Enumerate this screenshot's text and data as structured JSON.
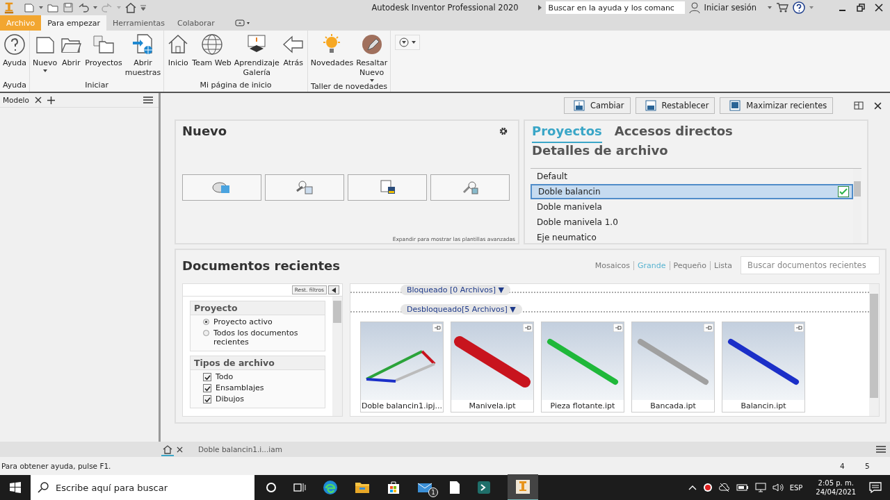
{
  "window": {
    "title": "Autodesk Inventor Professional 2020"
  },
  "help_search": {
    "placeholder": "Buscar en la ayuda y los comanc"
  },
  "sign_in": "Iniciar sesión",
  "ribbon_tabs": [
    {
      "label": "Archivo",
      "kind": "application",
      "selected": false
    },
    {
      "label": "Para empezar",
      "kind": "tab",
      "selected": true
    },
    {
      "label": "Herramientas",
      "kind": "tab",
      "selected": false
    },
    {
      "label": "Colaborar",
      "kind": "tab",
      "selected": false
    }
  ],
  "ribbon_groups": [
    {
      "label": "Ayuda",
      "buttons": [
        {
          "lines": [
            "Ayuda"
          ],
          "dropdown": false
        }
      ]
    },
    {
      "label": "Iniciar",
      "buttons": [
        {
          "lines": [
            "Nuevo"
          ],
          "dropdown": true
        },
        {
          "lines": [
            "Abrir"
          ],
          "dropdown": false
        },
        {
          "lines": [
            "Proyectos"
          ],
          "dropdown": false
        },
        {
          "lines": [
            "Abrir",
            "muestras"
          ],
          "dropdown": false
        }
      ]
    },
    {
      "label": "Mi página de inicio",
      "buttons": [
        {
          "lines": [
            "Inicio"
          ],
          "dropdown": false
        },
        {
          "lines": [
            "Team Web"
          ],
          "dropdown": false
        },
        {
          "lines": [
            "Aprendizaje",
            "Galería"
          ],
          "dropdown": false
        },
        {
          "lines": [
            "Atrás"
          ],
          "dropdown": false
        }
      ]
    },
    {
      "label": "Taller de novedades",
      "buttons": [
        {
          "lines": [
            "Novedades"
          ],
          "dropdown": false
        },
        {
          "lines": [
            "Resaltar",
            "Nuevo"
          ],
          "dropdown": true
        }
      ]
    }
  ],
  "browser": {
    "tab": "Modelo"
  },
  "toolbar": [
    "Cambiar",
    "Restablecer",
    "Maximizar recientes"
  ],
  "new_panel": {
    "title": "Nuevo",
    "hint": "Expandir para mostrar las plantillas avanzadas"
  },
  "project_tabs": [
    {
      "label": "Proyectos",
      "selected": true
    },
    {
      "label": "Accesos directos",
      "selected": false
    },
    {
      "label": "Detalles de archivo",
      "selected": false
    }
  ],
  "projects": [
    {
      "name": "Default",
      "selected": false,
      "active": false
    },
    {
      "name": "Doble balancin",
      "selected": true,
      "active": true
    },
    {
      "name": "Doble manivela",
      "selected": false,
      "active": false
    },
    {
      "name": "Doble manivela 1.0",
      "selected": false,
      "active": false
    },
    {
      "name": "Eje neumatico",
      "selected": false,
      "active": false
    }
  ],
  "recent": {
    "title": "Documentos recientes",
    "views": [
      {
        "label": "Mosaicos",
        "selected": false
      },
      {
        "label": "Grande",
        "selected": true
      },
      {
        "label": "Pequeño",
        "selected": false
      },
      {
        "label": "Lista",
        "selected": false
      }
    ],
    "search": {
      "placeholder": "Buscar documentos recientes"
    },
    "reset_filters": "Rest. filtros",
    "project_filter": {
      "title": "Proyecto",
      "options": [
        {
          "label": "Proyecto activo",
          "selected": true
        },
        {
          "label": "Todos los documentos recientes",
          "selected": false
        }
      ]
    },
    "type_filter": {
      "title": "Tipos de archivo",
      "options": [
        {
          "label": "Todo",
          "checked": true
        },
        {
          "label": "Ensamblajes",
          "checked": true
        },
        {
          "label": "Dibujos",
          "checked": true
        }
      ]
    },
    "groups": [
      "Bloqueado [0 Archivos] ▼",
      "Desbloqueado[5 Archivos] ▼"
    ],
    "files": [
      {
        "name": "Doble balancin1.ipj...",
        "kind": "assembly"
      },
      {
        "name": "Manivela.ipt",
        "kind": "part",
        "color": "#c8141e"
      },
      {
        "name": "Pieza flotante.ipt",
        "kind": "part",
        "color": "#1fb83a"
      },
      {
        "name": "Bancada.ipt",
        "kind": "part",
        "color": "#a0a0a0"
      },
      {
        "name": "Balancin.ipt",
        "kind": "part",
        "color": "#1b2fc8"
      }
    ]
  },
  "document_tabs": [
    {
      "label": "Doble balancin1.i...iam",
      "selected": false
    }
  ],
  "home_tab": {
    "selected": true
  },
  "status_bar": {
    "message": "Para obtener ayuda, pulse F1.",
    "fields": [
      "4",
      "5"
    ]
  },
  "taskbar": {
    "search_placeholder": "Escribe aquí para buscar",
    "mail_badge": "1",
    "language": "ESP",
    "time": "2:05 p. m.",
    "date": "24/04/2021"
  }
}
